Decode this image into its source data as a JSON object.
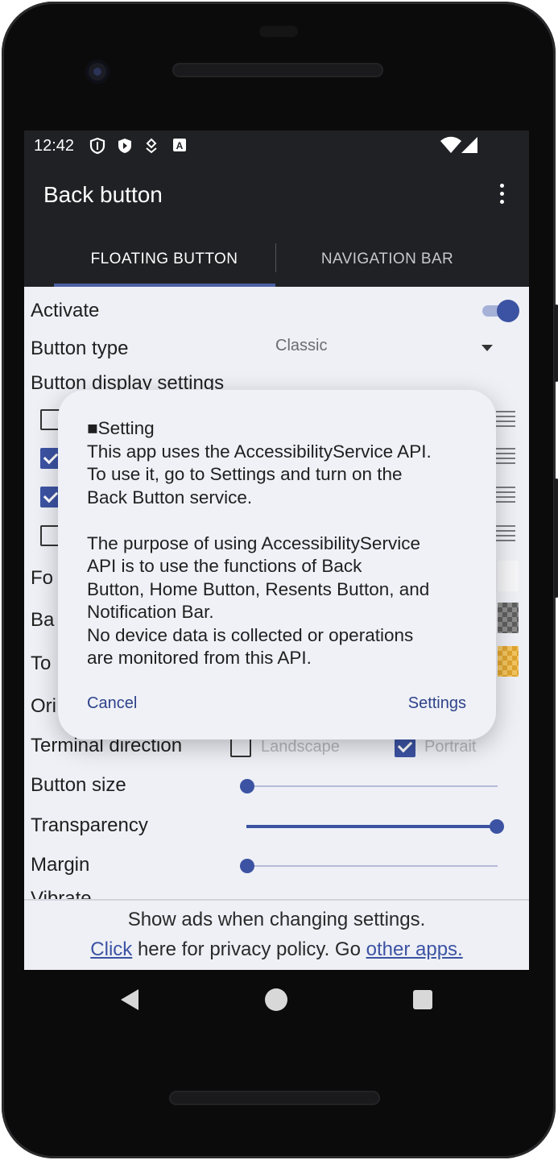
{
  "status_bar": {
    "time": "12:42",
    "icons": [
      "shield-icon",
      "shield-check-icon",
      "location-icon",
      "a-icon",
      "wifi-icon",
      "signal-icon"
    ]
  },
  "app_bar": {
    "title": "Back button",
    "menu_icon": "more-vert-icon"
  },
  "tabs": [
    {
      "label": "FLOATING BUTTON",
      "selected": true
    },
    {
      "label": "NAVIGATION BAR",
      "selected": false
    }
  ],
  "settings": {
    "activate_label": "Activate",
    "activate_on": true,
    "button_type_label": "Button type",
    "button_type_value": "Classic",
    "display_settings_label": "Button display settings",
    "display_checks": [
      false,
      true,
      true,
      false
    ],
    "partial_labels": [
      "Fo",
      "Ba",
      "To",
      "Ori"
    ],
    "terminal_direction_label": "Terminal direction",
    "landscape_label": "Landscape",
    "landscape_checked": false,
    "portrait_label": "Portrait",
    "portrait_checked": true,
    "button_size_label": "Button size",
    "button_size_value": 0,
    "transparency_label": "Transparency",
    "transparency_value": 1,
    "margin_label": "Margin",
    "margin_value": 0,
    "vibrate_label": "Vibrate"
  },
  "ad": {
    "line1": "Show ads when changing settings.",
    "click_label": "Click",
    "middle_text": " here for privacy policy. Go ",
    "other_apps_label": "other apps."
  },
  "dialog": {
    "body": "■Setting\nThis app uses the AccessibilityService API.\nTo use it, go to Settings and turn on the\nBack Button service.\n\nThe purpose of using AccessibilityService\nAPI is to use the functions of Back\nButton, Home Button, Resents Button, and\nNotification Bar.\nNo device data is collected or operations\nare monitored from this API.",
    "cancel_label": "Cancel",
    "settings_label": "Settings"
  },
  "colors": {
    "accent": "#3c53a3",
    "app_bar": "#202125",
    "background": "#eef0f6"
  }
}
